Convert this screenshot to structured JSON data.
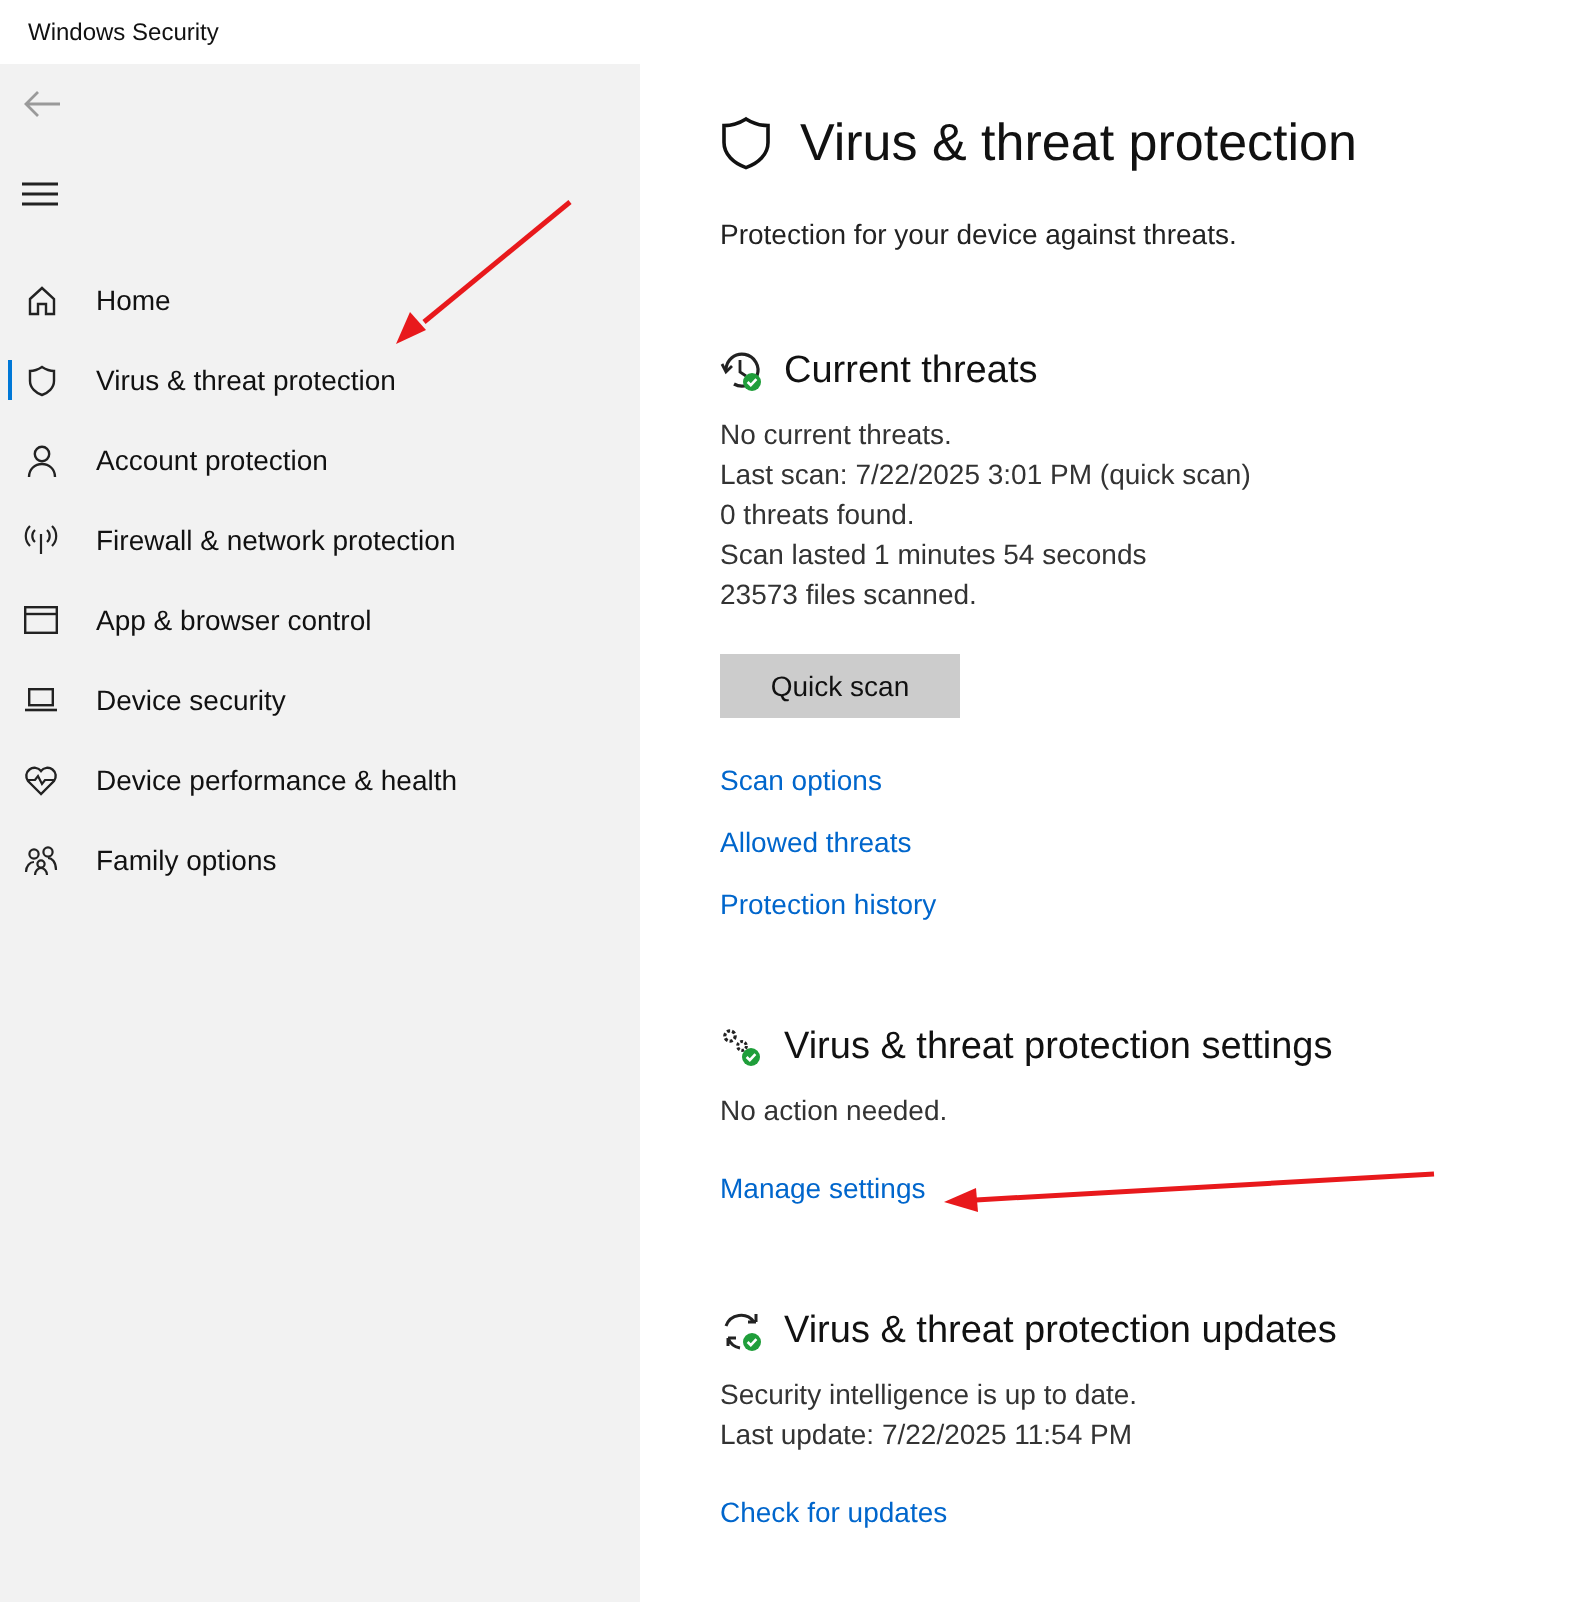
{
  "window": {
    "title": "Windows Security"
  },
  "sidebar": {
    "items": [
      {
        "label": "Home",
        "selected": false
      },
      {
        "label": "Virus & threat protection",
        "selected": true
      },
      {
        "label": "Account protection",
        "selected": false
      },
      {
        "label": "Firewall & network protection",
        "selected": false
      },
      {
        "label": "App & browser control",
        "selected": false
      },
      {
        "label": "Device security",
        "selected": false
      },
      {
        "label": "Device performance & health",
        "selected": false
      },
      {
        "label": "Family options",
        "selected": false
      }
    ]
  },
  "page": {
    "title": "Virus & threat protection",
    "subtitle": "Protection for your device against threats."
  },
  "sections": [
    {
      "heading": "Current threats",
      "lines": [
        "No current threats.",
        "Last scan: 7/22/2025 3:01 PM (quick scan)",
        "0 threats found.",
        "Scan lasted 1 minutes 54 seconds",
        "23573 files scanned."
      ],
      "button": "Quick scan",
      "links": [
        "Scan options",
        "Allowed threats",
        "Protection history"
      ]
    },
    {
      "heading": "Virus & threat protection settings",
      "lines": [
        "No action needed."
      ],
      "links": [
        "Manage settings"
      ]
    },
    {
      "heading": "Virus & threat protection updates",
      "lines": [
        "Security intelligence is up to date.",
        "Last update: 7/22/2025 11:54 PM"
      ],
      "links": [
        "Check for updates"
      ]
    }
  ]
}
